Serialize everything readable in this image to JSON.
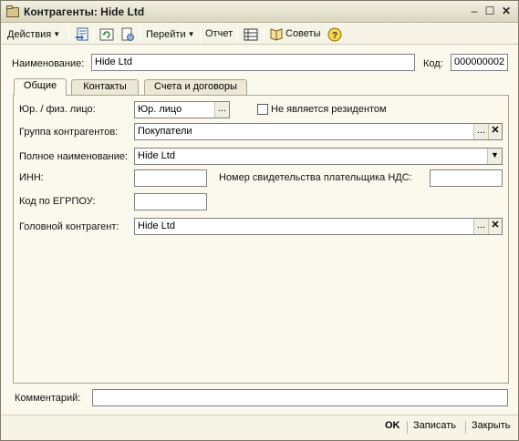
{
  "window": {
    "title": "Контрагенты: Hide Ltd"
  },
  "toolbar": {
    "actions_label": "Действия",
    "goto_label": "Перейти",
    "report_label": "Отчет",
    "tips_label": "Советы"
  },
  "header": {
    "name_label": "Наименование:",
    "name_value": "Hide Ltd",
    "code_label": "Код:",
    "code_value": "000000002"
  },
  "tabs": [
    {
      "label": "Общие",
      "active": true
    },
    {
      "label": "Контакты",
      "active": false
    },
    {
      "label": "Счета и договоры",
      "active": false
    }
  ],
  "general": {
    "entity_type_label": "Юр. / физ. лицо:",
    "entity_type_value": "Юр. лицо",
    "nonresident_label": "Не является резидентом",
    "nonresident_checked": false,
    "group_label": "Группа контрагентов:",
    "group_value": "Покупатели",
    "fullname_label": "Полное наименование:",
    "fullname_value": "Hide Ltd",
    "inn_label": "ИНН:",
    "inn_value": "",
    "vat_cert_label": "Номер свидетельства плательщика НДС:",
    "vat_cert_value": "",
    "edrpou_label": "Код по ЕГРПОУ:",
    "edrpou_value": "",
    "head_label": "Головной контрагент:",
    "head_value": "Hide Ltd"
  },
  "comment": {
    "label": "Комментарий:",
    "value": ""
  },
  "buttons": {
    "ok": "OK",
    "save": "Записать",
    "close": "Закрыть"
  }
}
